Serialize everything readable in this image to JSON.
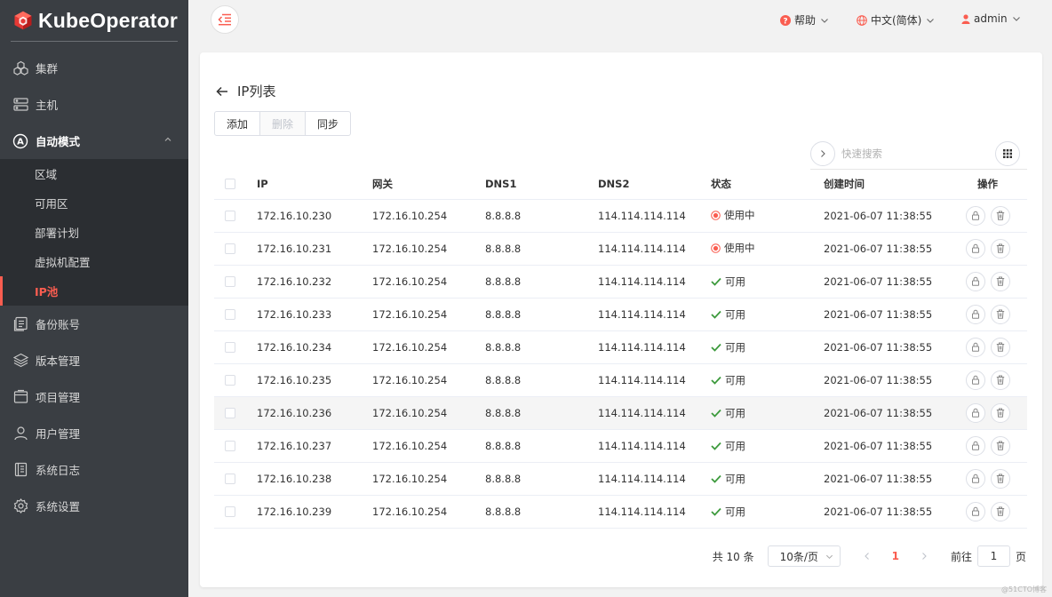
{
  "brand": {
    "name": "KubeOperator",
    "color": "#e53935"
  },
  "sidebar": {
    "items": [
      {
        "label": "集群",
        "icon": "cluster-icon"
      },
      {
        "label": "主机",
        "icon": "server-icon"
      },
      {
        "label": "自动模式",
        "icon": "automation-icon",
        "open": true
      },
      {
        "label": "备份账号",
        "icon": "backup-icon"
      },
      {
        "label": "版本管理",
        "icon": "layers-icon"
      },
      {
        "label": "项目管理",
        "icon": "project-icon"
      },
      {
        "label": "用户管理",
        "icon": "user-icon"
      },
      {
        "label": "系统日志",
        "icon": "log-icon"
      },
      {
        "label": "系统设置",
        "icon": "gear-icon"
      }
    ],
    "submenu": [
      {
        "label": "区域",
        "active": false
      },
      {
        "label": "可用区",
        "active": false
      },
      {
        "label": "部署计划",
        "active": false
      },
      {
        "label": "虚拟机配置",
        "active": false
      },
      {
        "label": "IP池",
        "active": true
      }
    ]
  },
  "header": {
    "help": "帮助",
    "language": "中文(简体)",
    "user": "admin"
  },
  "page": {
    "title": "IP列表",
    "buttons": {
      "add": "添加",
      "delete": "删除",
      "sync": "同步"
    },
    "search_placeholder": "快速搜索"
  },
  "table": {
    "columns": {
      "ip": "IP",
      "gateway": "网关",
      "dns1": "DNS1",
      "dns2": "DNS2",
      "status": "状态",
      "created": "创建时间",
      "actions": "操作"
    },
    "rows": [
      {
        "ip": "172.16.10.230",
        "gateway": "172.16.10.254",
        "dns1": "8.8.8.8",
        "dns2": "114.114.114.114",
        "status": "使用中",
        "status_kind": "in-use",
        "created": "2021-06-07 11:38:55"
      },
      {
        "ip": "172.16.10.231",
        "gateway": "172.16.10.254",
        "dns1": "8.8.8.8",
        "dns2": "114.114.114.114",
        "status": "使用中",
        "status_kind": "in-use",
        "created": "2021-06-07 11:38:55"
      },
      {
        "ip": "172.16.10.232",
        "gateway": "172.16.10.254",
        "dns1": "8.8.8.8",
        "dns2": "114.114.114.114",
        "status": "可用",
        "status_kind": "available",
        "created": "2021-06-07 11:38:55"
      },
      {
        "ip": "172.16.10.233",
        "gateway": "172.16.10.254",
        "dns1": "8.8.8.8",
        "dns2": "114.114.114.114",
        "status": "可用",
        "status_kind": "available",
        "created": "2021-06-07 11:38:55"
      },
      {
        "ip": "172.16.10.234",
        "gateway": "172.16.10.254",
        "dns1": "8.8.8.8",
        "dns2": "114.114.114.114",
        "status": "可用",
        "status_kind": "available",
        "created": "2021-06-07 11:38:55"
      },
      {
        "ip": "172.16.10.235",
        "gateway": "172.16.10.254",
        "dns1": "8.8.8.8",
        "dns2": "114.114.114.114",
        "status": "可用",
        "status_kind": "available",
        "created": "2021-06-07 11:38:55"
      },
      {
        "ip": "172.16.10.236",
        "gateway": "172.16.10.254",
        "dns1": "8.8.8.8",
        "dns2": "114.114.114.114",
        "status": "可用",
        "status_kind": "available",
        "created": "2021-06-07 11:38:55",
        "hover": true
      },
      {
        "ip": "172.16.10.237",
        "gateway": "172.16.10.254",
        "dns1": "8.8.8.8",
        "dns2": "114.114.114.114",
        "status": "可用",
        "status_kind": "available",
        "created": "2021-06-07 11:38:55"
      },
      {
        "ip": "172.16.10.238",
        "gateway": "172.16.10.254",
        "dns1": "8.8.8.8",
        "dns2": "114.114.114.114",
        "status": "可用",
        "status_kind": "available",
        "created": "2021-06-07 11:38:55"
      },
      {
        "ip": "172.16.10.239",
        "gateway": "172.16.10.254",
        "dns1": "8.8.8.8",
        "dns2": "114.114.114.114",
        "status": "可用",
        "status_kind": "available",
        "created": "2021-06-07 11:38:55"
      }
    ]
  },
  "pagination": {
    "total": "共 10 条",
    "page_size": "10条/页",
    "current": "1",
    "goto_label": "前往",
    "goto_value": "1",
    "page_suffix": "页"
  },
  "watermark": "@51CTO博客",
  "colors": {
    "accent": "#fa5d50",
    "ok": "#3c9a3c",
    "sidebar_bg": "#3a3e43",
    "submenu_bg": "#2b2e32"
  }
}
